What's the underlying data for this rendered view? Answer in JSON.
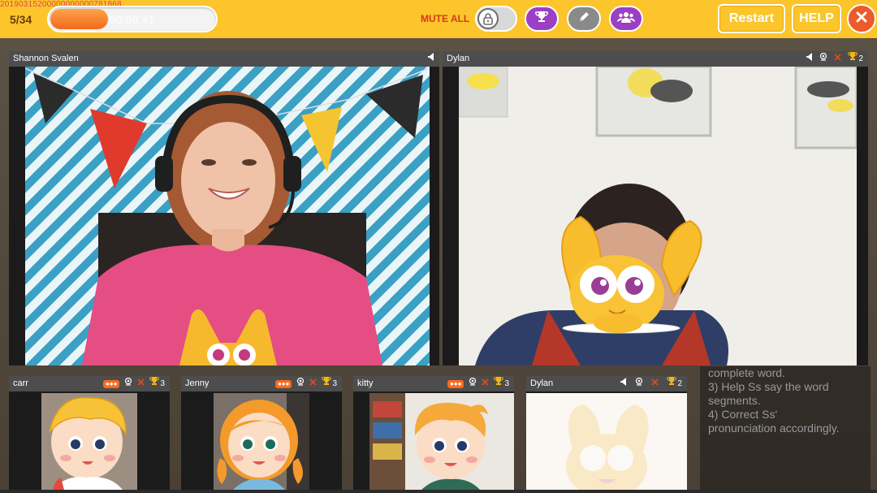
{
  "session": {
    "id": "20190315200000000000781868",
    "page": "5/34",
    "timer": "00:08:41",
    "progress_fraction": 0.35
  },
  "toolbar": {
    "mute_all": "MUTE ALL",
    "restart": "Restart",
    "help": "HELP"
  },
  "colors": {
    "topbar": "#fbc52b",
    "purple": "#9b3fc4",
    "close": "#ec5b2a",
    "trophy": "#f2b617",
    "remove": "#e04a1a"
  },
  "teacher": {
    "name": "Shannon Svalen"
  },
  "main_student": {
    "name": "Dylan",
    "trophies": "2"
  },
  "students": [
    {
      "name": "carr",
      "cam_badge": "camera-off",
      "trophies": "3"
    },
    {
      "name": "Jenny",
      "cam_badge": "camera-off",
      "trophies": "3"
    },
    {
      "name": "kitty",
      "cam_badge": "camera-off",
      "trophies": "3"
    },
    {
      "name": "Dylan",
      "trophies": "2"
    }
  ],
  "notes": {
    "lines": [
      "complete word.",
      "3) Help Ss say the word",
      "segments.",
      "4) Correct Ss'",
      "pronunciation accordingly."
    ]
  },
  "icons": {
    "lock": "lock-icon",
    "trophy": "trophy-icon",
    "pencil": "pencil-icon",
    "group": "group-icon",
    "close": "close-icon",
    "speaker": "speaker-icon",
    "mic": "mic-icon",
    "remove": "remove-icon"
  }
}
